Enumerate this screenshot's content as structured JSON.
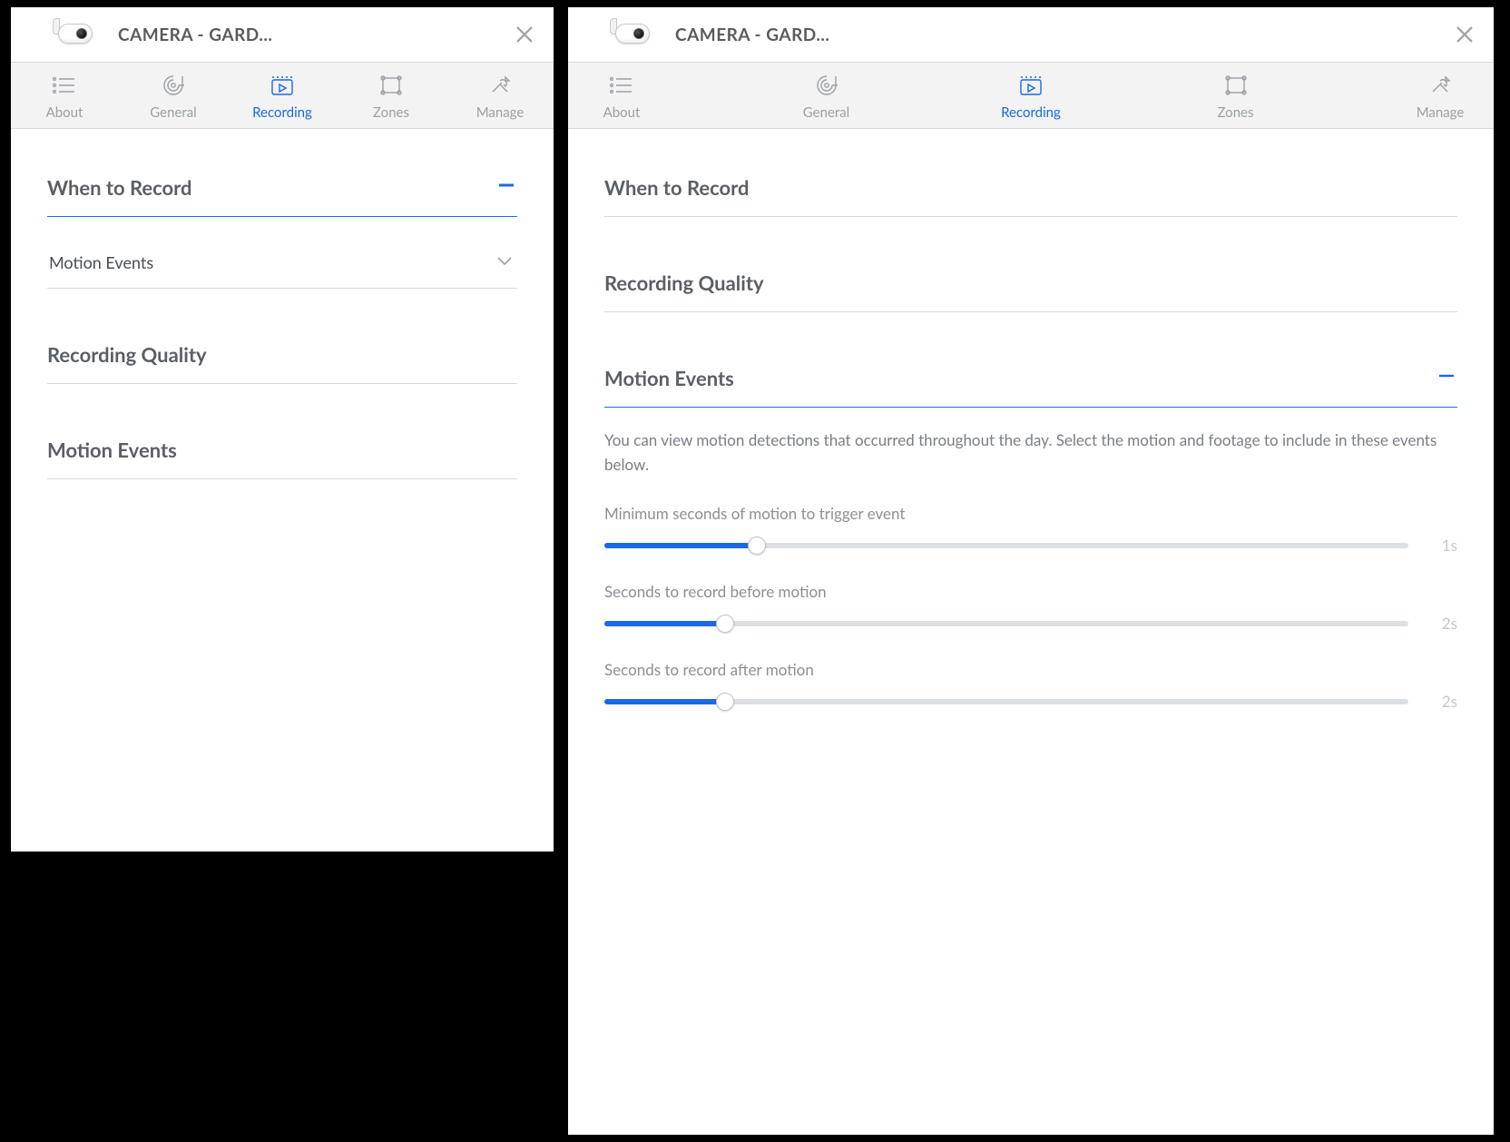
{
  "header": {
    "title": "CAMERA - GARD..."
  },
  "tabs": {
    "about": "About",
    "general": "General",
    "recording": "Recording",
    "zones": "Zones",
    "manage": "Manage"
  },
  "left": {
    "sections": {
      "when_to_record": "When to Record",
      "recording_quality": "Recording Quality",
      "motion_events": "Motion Events"
    },
    "when_to_record_dropdown": {
      "selected": "Motion Events"
    }
  },
  "right": {
    "sections": {
      "when_to_record": "When to Record",
      "recording_quality": "Recording Quality",
      "motion_events": "Motion Events"
    },
    "motion_events": {
      "description": "You can view motion detections that occurred throughout the day. Select the motion and footage to include in these events below.",
      "sliders": {
        "min_trigger": {
          "label": "Minimum seconds of motion to trigger event",
          "value_text": "1s",
          "fill_pct": 19
        },
        "before": {
          "label": "Seconds to record before motion",
          "value_text": "2s",
          "fill_pct": 15
        },
        "after": {
          "label": "Seconds to record after motion",
          "value_text": "2s",
          "fill_pct": 15
        }
      }
    }
  }
}
